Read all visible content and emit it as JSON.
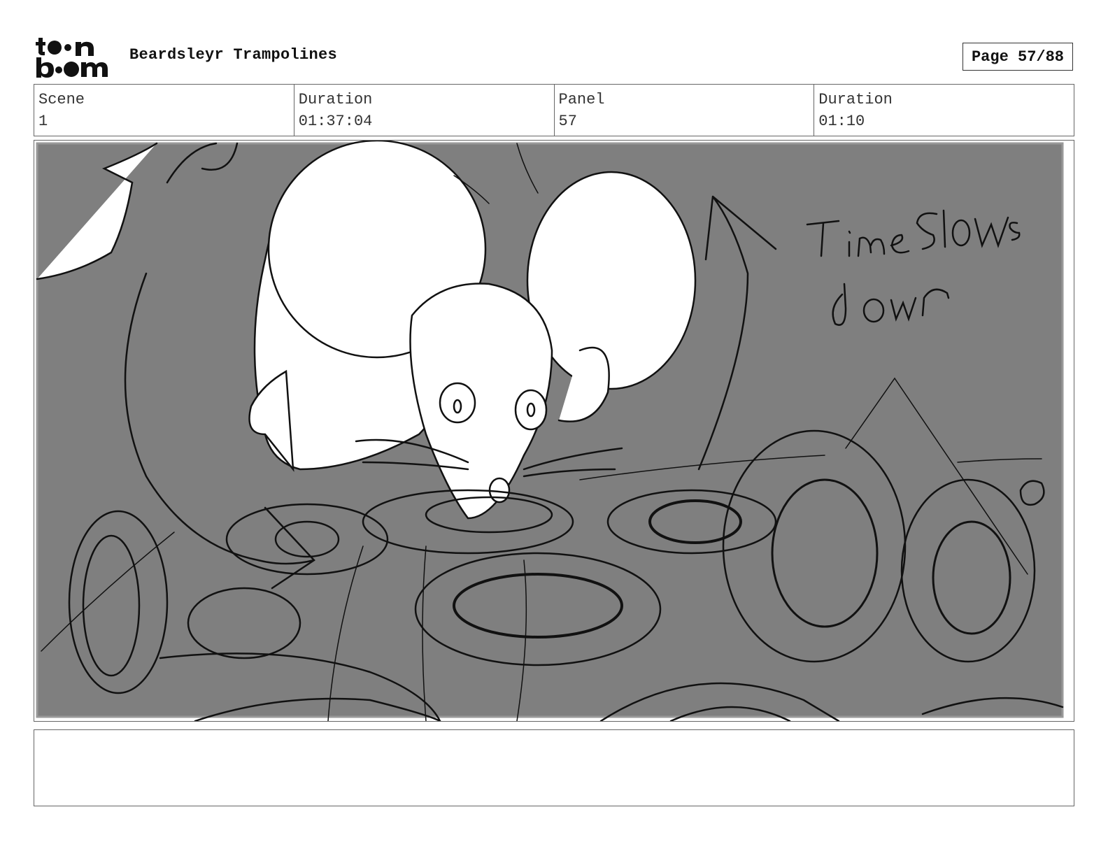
{
  "header": {
    "logo_text": "toon boom",
    "project_title": "Beardsleyr Trampolines",
    "page_label": "Page 57/88"
  },
  "info": {
    "scene_label": "Scene",
    "scene_value": "1",
    "scene_duration_label": "Duration",
    "scene_duration_value": "01:37:04",
    "panel_label": "Panel",
    "panel_value": "57",
    "panel_duration_label": "Duration",
    "panel_duration_value": "01:10"
  },
  "panel": {
    "handwritten_note": "Time slows down",
    "background_color": "#7f7f7f"
  },
  "notes": {
    "text": ""
  }
}
